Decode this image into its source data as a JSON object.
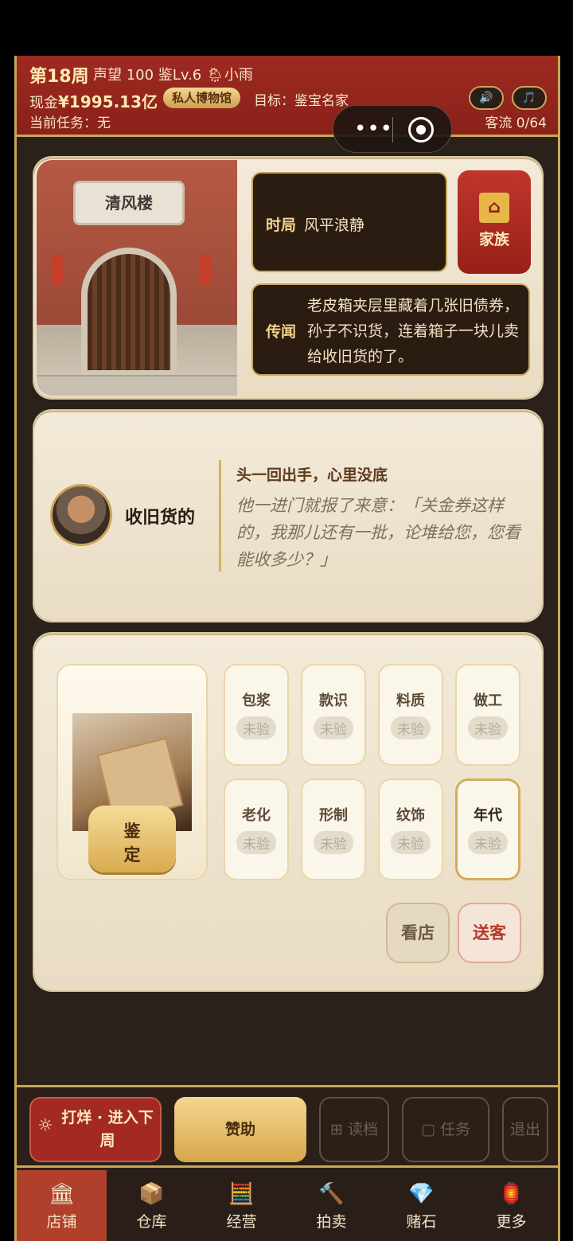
{
  "header": {
    "week": "第18周",
    "stats": "声望 100 鉴Lv.6 🌦小雨",
    "cash_prefix": "现金",
    "cash_value": "¥1995.13亿",
    "museum_badge": "私人博物馆",
    "goal": "目标：鉴宝名家",
    "task": "当前任务：无",
    "flow": "客流 0/64",
    "sound_icon": "🔊",
    "music_icon": "🎵"
  },
  "shop": {
    "plaque": "清风楼",
    "situation_label": "时局",
    "situation_value": "风平浪静",
    "family_label": "家族",
    "rumor_label": "传闻",
    "rumor_text": "老皮箱夹层里藏着几张旧债券，孙子不识货，连着箱子一块儿卖给收旧货的了。"
  },
  "npc": {
    "name": "收旧货的",
    "title": "头一回出手，心里没底",
    "quote": "他一进门就报了来意：「关金券这样的，我那儿还有一批，论堆给您，您看能收多少？」"
  },
  "appraise": {
    "button_line1": "鉴",
    "button_line2": "定",
    "attributes": [
      {
        "name": "包浆",
        "status": "未验"
      },
      {
        "name": "款识",
        "status": "未验"
      },
      {
        "name": "料质",
        "status": "未验"
      },
      {
        "name": "做工",
        "status": "未验"
      },
      {
        "name": "老化",
        "status": "未验"
      },
      {
        "name": "形制",
        "status": "未验"
      },
      {
        "name": "纹饰",
        "status": "未验"
      },
      {
        "name": "年代",
        "status": "未验"
      }
    ],
    "view_shop": "看店",
    "send_off": "送客"
  },
  "actions": {
    "next_week": "打烊 · 进入下周",
    "sponsor": "赞助",
    "load": "读档",
    "tasks": "任务",
    "exit": "退出"
  },
  "tabs": [
    {
      "label": "店铺",
      "icon": "🏛"
    },
    {
      "label": "仓库",
      "icon": "📦"
    },
    {
      "label": "经营",
      "icon": "🧮"
    },
    {
      "label": "拍卖",
      "icon": "🔨"
    },
    {
      "label": "赌石",
      "icon": "💎"
    },
    {
      "label": "更多",
      "icon": "🏮"
    }
  ],
  "colors": {
    "header_red": "#9d2a22",
    "gold": "#c9a659",
    "dark_panel": "#2b1c12",
    "active_tab": "#b0402b"
  }
}
